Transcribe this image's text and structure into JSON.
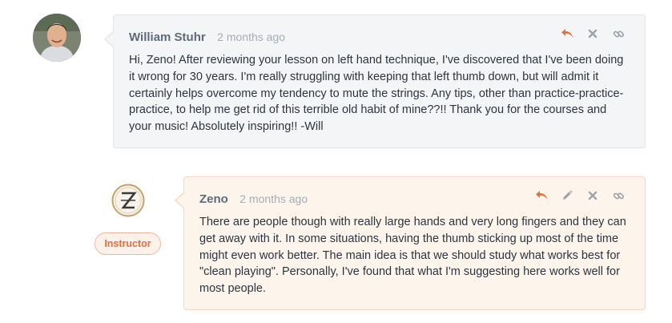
{
  "comments": [
    {
      "author": "William Stuhr",
      "time": "2 months ago",
      "body": "Hi, Zeno!  After reviewing your lesson on left hand technique, I've discovered that I've been doing it wrong for 30 years.  I'm really struggling with keeping that left thumb down, but will admit it certainly helps overcome my tendency to mute the strings.  Any tips, other than practice-practice-practice, to help me get rid of this terrible old habit of mine??!!  Thank you for the courses and your music!  Absolutely inspiring!!  -Will",
      "actions": [
        "reply-icon",
        "delete-icon",
        "link-icon"
      ]
    },
    {
      "author": "Zeno",
      "time": "2 months ago",
      "badge": "Instructor",
      "body": "There are people though with really large hands and very long fingers and they can get away with it. In some situations, having the thumb sticking up most of the time might even work better. The main idea is that we should study what works best for \"clean playing\". Personally, I've found that what I'm suggesting here works well for most people.",
      "actions": [
        "reply-icon",
        "edit-icon",
        "delete-icon",
        "link-icon"
      ]
    }
  ],
  "colors": {
    "accent": "#e8733a",
    "icon_gray": "#9aa3ad",
    "author_text": "#5f6b78"
  }
}
